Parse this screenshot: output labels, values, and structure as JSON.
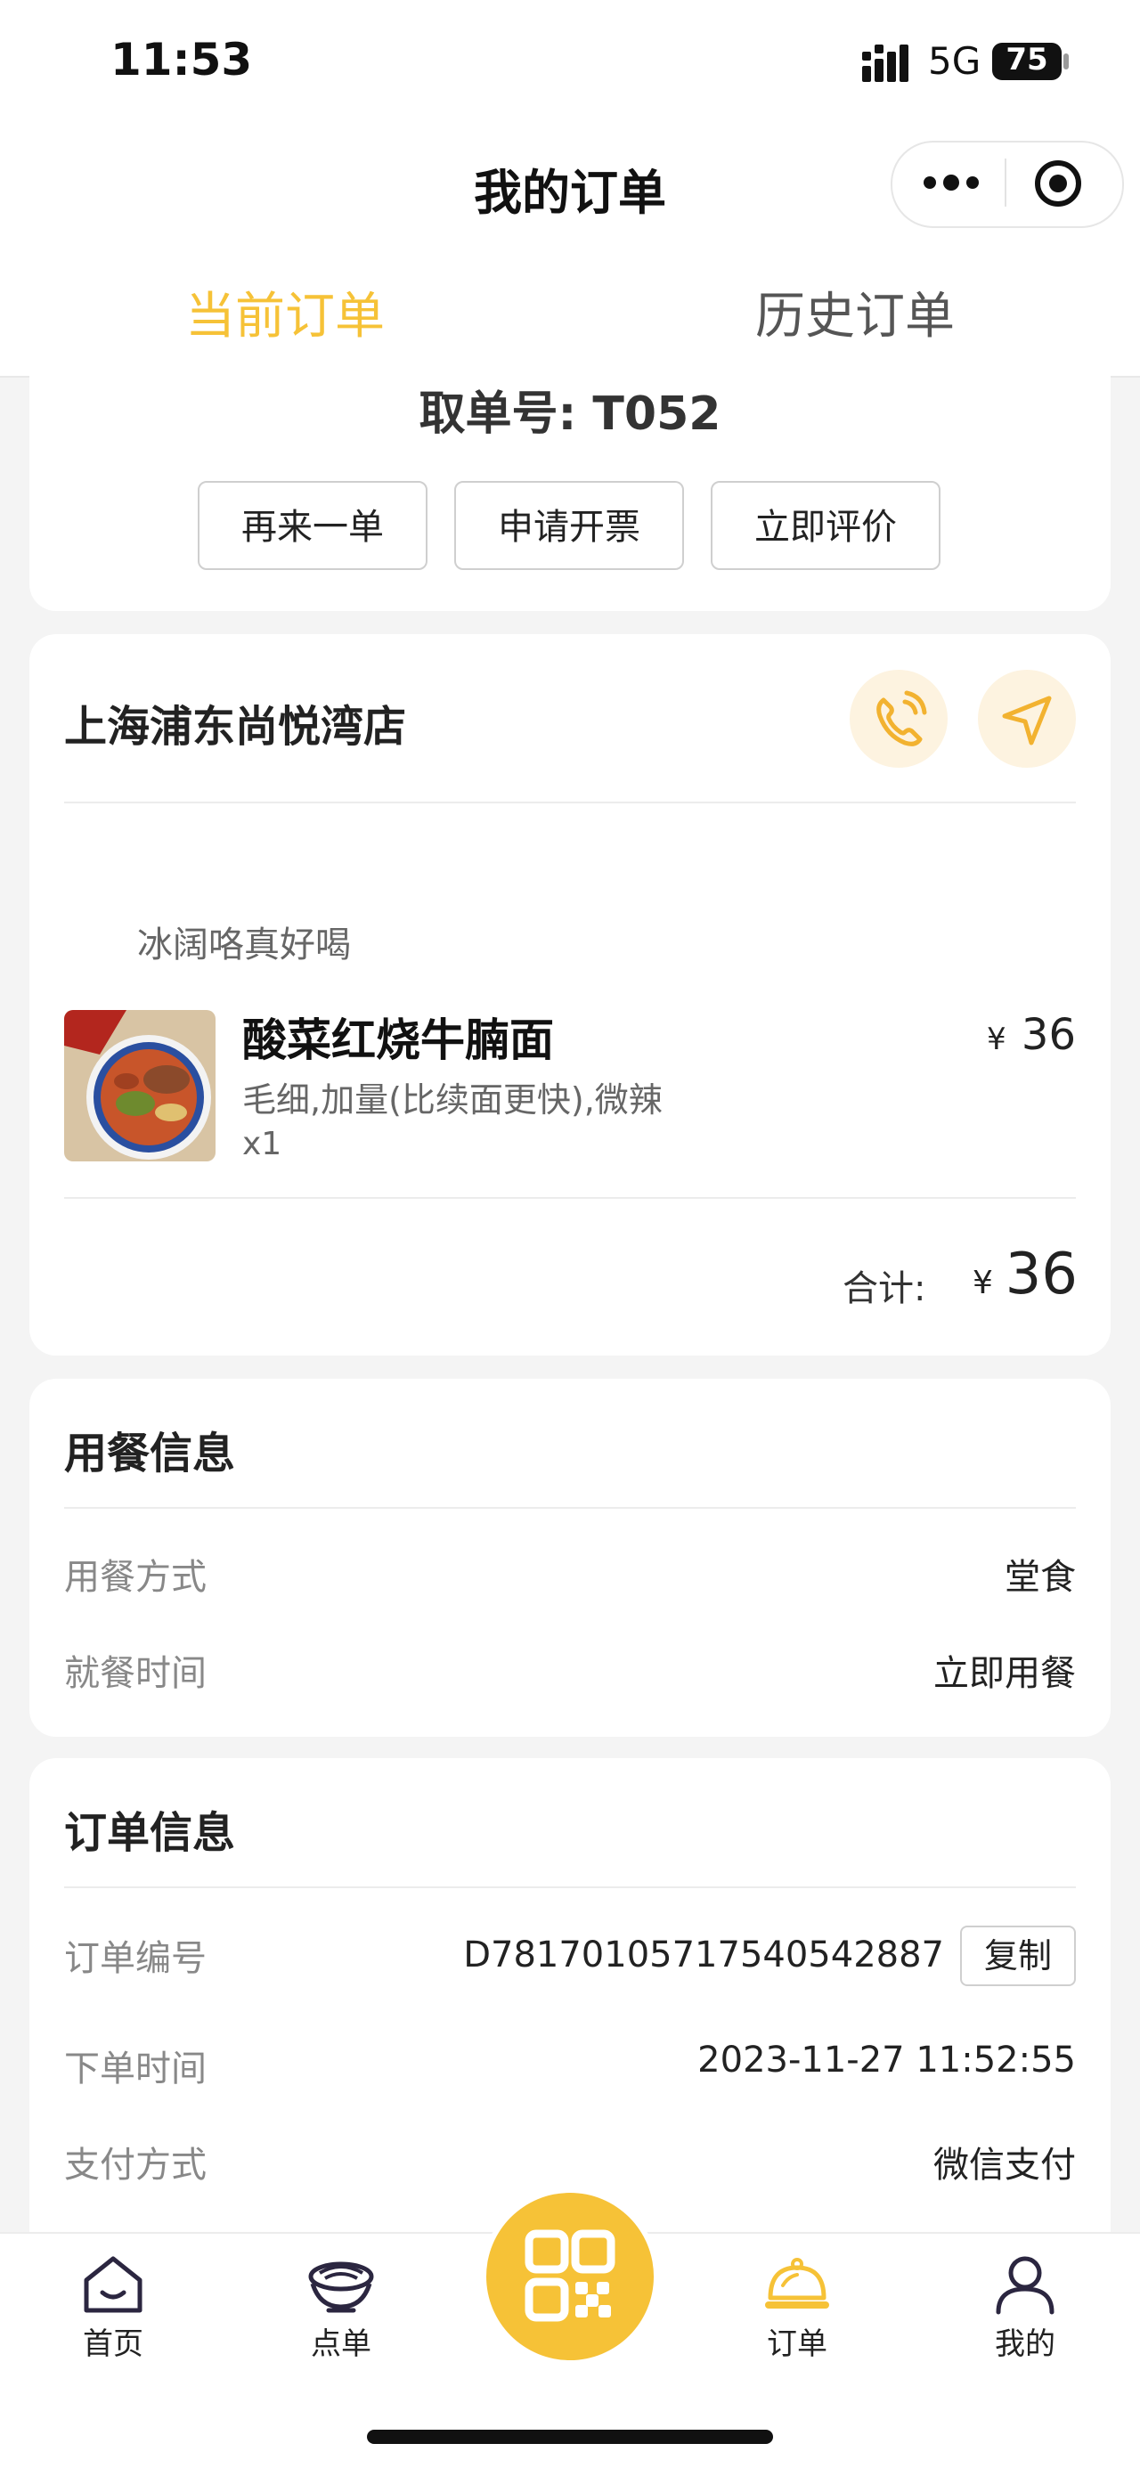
{
  "status_bar": {
    "time": "11:53",
    "network": "5G",
    "battery": "75"
  },
  "nav": {
    "title": "我的订单"
  },
  "tabs": [
    {
      "label": "当前订单",
      "active": true
    },
    {
      "label": "历史订单",
      "active": false
    }
  ],
  "order_card": {
    "pickup_number": "取单号: T052",
    "actions": [
      "再来一单",
      "申请开票",
      "立即评价"
    ]
  },
  "store": {
    "name": "上海浦东尚悦湾店",
    "remark": "冰阔咯真好喝",
    "item": {
      "name": "酸菜红烧牛腩面",
      "currency": "¥",
      "price": "36",
      "spec": "毛细,加量(比续面更快),微辣",
      "qty": "x1"
    },
    "total_label": "合计:",
    "total_currency": "¥",
    "total": "36"
  },
  "dining_info": {
    "title": "用餐信息",
    "rows": [
      {
        "label": "用餐方式",
        "value": "堂食"
      },
      {
        "label": "就餐时间",
        "value": "立即用餐"
      }
    ]
  },
  "order_info": {
    "title": "订单信息",
    "order_no_label": "订单编号",
    "order_no": "D78170105717540542887",
    "copy_label": "复制",
    "time_label": "下单时间",
    "time": "2023-11-27 11:52:55",
    "pay_label": "支付方式",
    "pay": "微信支付"
  },
  "tab_bar": {
    "items": [
      {
        "label": "首页",
        "icon": "home-icon"
      },
      {
        "label": "点单",
        "icon": "noodle-bowl-icon"
      },
      {
        "label": "",
        "icon": "qr-code-icon"
      },
      {
        "label": "订单",
        "icon": "cloche-icon"
      },
      {
        "label": "我的",
        "icon": "user-icon"
      }
    ]
  },
  "colors": {
    "accent": "#f6c237",
    "background": "#f4f4f4"
  }
}
